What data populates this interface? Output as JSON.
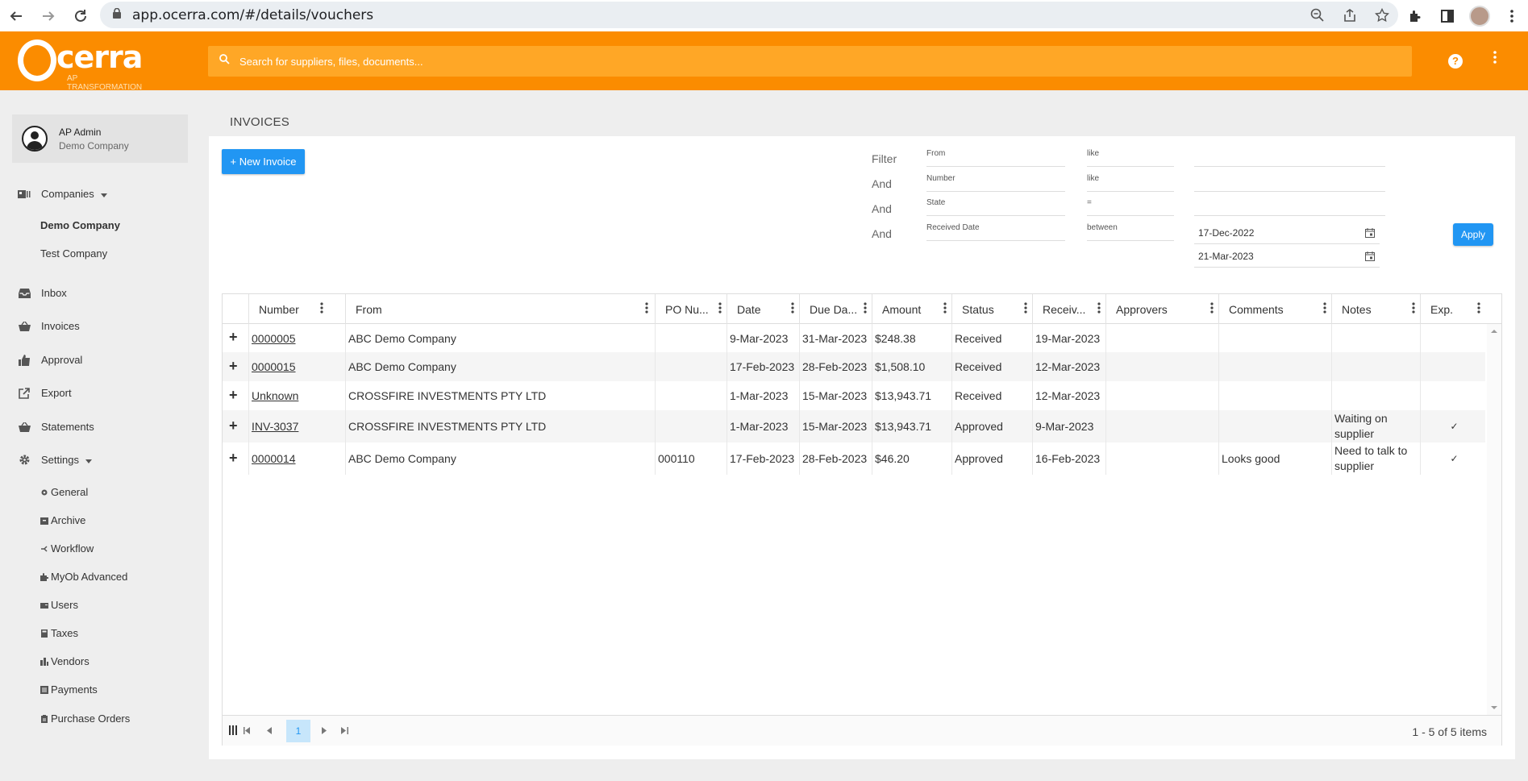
{
  "browser": {
    "url": "app.ocerra.com/#/details/vouchers"
  },
  "header": {
    "logo_text": "cerra",
    "logo_sub": "AP TRANSFORMATION",
    "search_placeholder": "Search for suppliers, files, documents...",
    "help": "?"
  },
  "sidebar": {
    "user_name": "AP Admin",
    "user_company": "Demo Company",
    "companies_label": "Companies",
    "companies": [
      "Demo Company",
      "Test Company"
    ],
    "items": {
      "inbox": "Inbox",
      "invoices": "Invoices",
      "approval": "Approval",
      "export": "Export",
      "statements": "Statements",
      "settings": "Settings"
    },
    "settings_items": [
      "General",
      "Archive",
      "Workflow",
      "MyOb Advanced",
      "Users",
      "Taxes",
      "Vendors",
      "Payments",
      "Purchase Orders"
    ]
  },
  "main": {
    "title": "INVOICES",
    "new_button": "+ New Invoice",
    "apply_button": "Apply"
  },
  "filters": [
    {
      "conj": "Filter",
      "field": "From",
      "op": "like",
      "value": ""
    },
    {
      "conj": "And",
      "field": "Number",
      "op": "like",
      "value": ""
    },
    {
      "conj": "And",
      "field": "State",
      "op": "=",
      "value": ""
    },
    {
      "conj": "And",
      "field": "Received Date",
      "op": "between",
      "from": "17-Dec-2022",
      "to": "21-Mar-2023"
    }
  ],
  "table": {
    "columns": [
      "Number",
      "From",
      "PO Nu...",
      "Date",
      "Due Da...",
      "Amount",
      "Status",
      "Receiv...",
      "Approvers",
      "Comments",
      "Notes",
      "Exp."
    ],
    "rows": [
      {
        "number": "0000005",
        "from": "ABC Demo Company",
        "po": "",
        "date": "9-Mar-2023",
        "due": "31-Mar-2023",
        "amount": "$248.38",
        "status": "Received",
        "received": "19-Mar-2023",
        "approvers": "",
        "comments": "",
        "notes": "",
        "exp": ""
      },
      {
        "number": "0000015",
        "from": "ABC Demo Company",
        "po": "",
        "date": "17-Feb-2023",
        "due": "28-Feb-2023",
        "amount": "$1,508.10",
        "status": "Received",
        "received": "12-Mar-2023",
        "approvers": "",
        "comments": "",
        "notes": "",
        "exp": ""
      },
      {
        "number": "Unknown",
        "from": "CROSSFIRE INVESTMENTS PTY LTD",
        "po": "",
        "date": "1-Mar-2023",
        "due": "15-Mar-2023",
        "amount": "$13,943.71",
        "status": "Received",
        "received": "12-Mar-2023",
        "approvers": "",
        "comments": "",
        "notes": "",
        "exp": ""
      },
      {
        "number": "INV-3037",
        "from": "CROSSFIRE INVESTMENTS PTY LTD",
        "po": "",
        "date": "1-Mar-2023",
        "due": "15-Mar-2023",
        "amount": "$13,943.71",
        "status": "Approved",
        "received": "9-Mar-2023",
        "approvers": "",
        "comments": "",
        "notes": "Waiting on supplier",
        "exp": "✓"
      },
      {
        "number": "0000014",
        "from": "ABC Demo Company",
        "po": "000110",
        "date": "17-Feb-2023",
        "due": "28-Feb-2023",
        "amount": "$46.20",
        "status": "Approved",
        "received": "16-Feb-2023",
        "approvers": "",
        "comments": "Looks good",
        "notes": "Need to talk to supplier",
        "exp": "✓"
      }
    ]
  },
  "pagination": {
    "current_page": "1",
    "items_info": "1 - 5 of 5 items"
  },
  "colors": {
    "brand_orange": "#fb8c00",
    "search_orange": "#ffa726",
    "primary_blue": "#2196f3"
  }
}
